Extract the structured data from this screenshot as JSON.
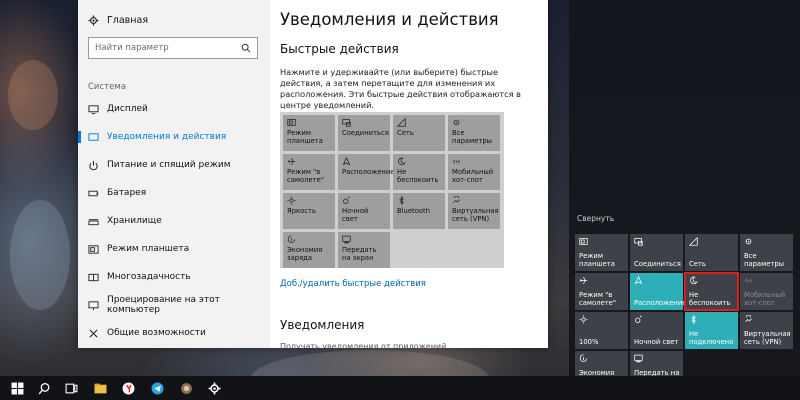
{
  "settings": {
    "home_label": "Главная",
    "search_placeholder": "Найти параметр",
    "section_label": "Система",
    "nav": [
      {
        "label": "Дисплей",
        "icon": "display-icon"
      },
      {
        "label": "Уведомления и действия",
        "icon": "notifications-icon",
        "active": true
      },
      {
        "label": "Питание и спящий режим",
        "icon": "power-icon"
      },
      {
        "label": "Батарея",
        "icon": "battery-icon"
      },
      {
        "label": "Хранилище",
        "icon": "storage-icon"
      },
      {
        "label": "Режим планшета",
        "icon": "tablet-mode-icon"
      },
      {
        "label": "Многозадачность",
        "icon": "multitasking-icon"
      },
      {
        "label": "Проецирование на этот компьютер",
        "icon": "projecting-icon"
      },
      {
        "label": "Общие возможности",
        "icon": "shared-experiences-icon"
      }
    ],
    "page_title": "Уведомления и действия",
    "quick_actions_heading": "Быстрые действия",
    "quick_actions_description": "Нажмите и удерживайте (или выберите) быстрые действия, а затем перетащите для изменения их расположения. Эти быстрые действия отображаются в центре уведомлений.",
    "quick_action_tiles": [
      {
        "label": "Режим планшета",
        "icon": "tablet-mode-icon"
      },
      {
        "label": "Соединиться",
        "icon": "connect-icon"
      },
      {
        "label": "Сеть",
        "icon": "network-icon"
      },
      {
        "label": "Все параметры",
        "icon": "gear-icon"
      },
      {
        "label": "Режим \"в самолете\"",
        "icon": "airplane-icon"
      },
      {
        "label": "Расположение",
        "icon": "location-icon"
      },
      {
        "label": "Не беспокоить",
        "icon": "moon-icon"
      },
      {
        "label": "Мобильный хот-спот",
        "icon": "hotspot-icon"
      },
      {
        "label": "Яркость",
        "icon": "brightness-icon"
      },
      {
        "label": "Ночной свет",
        "icon": "night-light-icon"
      },
      {
        "label": "Bluetooth",
        "icon": "bluetooth-icon"
      },
      {
        "label": "Виртуальная сеть (VPN)",
        "icon": "vpn-icon"
      },
      {
        "label": "Экономия заряда",
        "icon": "battery-saver-icon"
      },
      {
        "label": "Передать на экран",
        "icon": "project-icon"
      }
    ],
    "add_remove_link": "Доб./удалить быстрые действия",
    "notifications_heading": "Уведомления",
    "cut_text": "Получать уведомления от приложений"
  },
  "action_center": {
    "collapse_label": "Свернуть",
    "tiles": [
      {
        "label": "Режим планшета",
        "icon": "tablet-mode-icon",
        "state": "off"
      },
      {
        "label": "Соединиться",
        "icon": "connect-icon",
        "state": "off"
      },
      {
        "label": "Сеть",
        "icon": "network-icon",
        "state": "off"
      },
      {
        "label": "Все параметры",
        "icon": "gear-icon",
        "state": "off"
      },
      {
        "label": "Режим \"в самолете\"",
        "icon": "airplane-icon",
        "state": "off"
      },
      {
        "label": "Расположение",
        "icon": "location-icon",
        "state": "on"
      },
      {
        "label": "Не беспокоить",
        "icon": "moon-icon",
        "state": "highlight"
      },
      {
        "label": "Мобильный хот-спот",
        "icon": "hotspot-icon",
        "state": "dim"
      },
      {
        "label": "100%",
        "icon": "brightness-icon",
        "state": "off"
      },
      {
        "label": "Ночной свет",
        "icon": "night-light-icon",
        "state": "off"
      },
      {
        "label": "Не подключено",
        "icon": "bluetooth-icon",
        "state": "on"
      },
      {
        "label": "Виртуальная сеть (VPN)",
        "icon": "vpn-icon",
        "state": "off"
      },
      {
        "label": "Экономия заряда",
        "icon": "battery-saver-icon",
        "state": "off"
      },
      {
        "label": "Передать на экран",
        "icon": "project-icon",
        "state": "off"
      }
    ],
    "highlight_color": "#e21b1b",
    "on_color": "#2eaeb7"
  },
  "taskbar": {
    "icons": [
      "windows-start-icon",
      "search-icon",
      "task-view-icon",
      "file-explorer-icon",
      "yandex-browser-icon",
      "telegram-icon",
      "game-app-icon",
      "settings-icon"
    ]
  }
}
